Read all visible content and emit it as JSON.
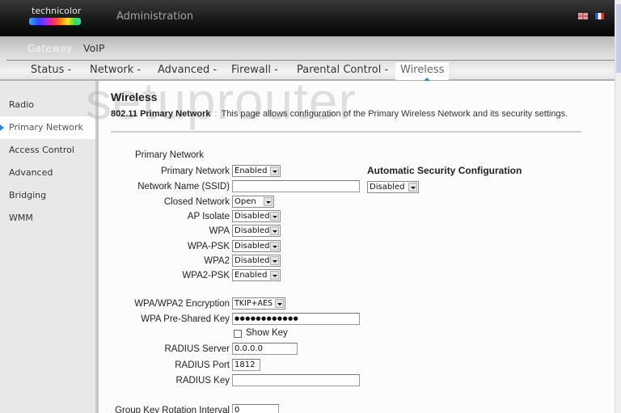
{
  "header": {
    "brand": "technicolor",
    "title": "Administration",
    "languages": [
      {
        "code": "en",
        "icon": "uk-flag-icon"
      },
      {
        "code": "fr",
        "icon": "france-flag-icon"
      }
    ]
  },
  "subnav": {
    "items": [
      {
        "label": "Gateway",
        "active": true
      },
      {
        "label": "VoIP",
        "active": false
      }
    ]
  },
  "mainnav": {
    "items": [
      {
        "label": "Status -"
      },
      {
        "label": "Network -"
      },
      {
        "label": "Advanced -"
      },
      {
        "label": "Firewall -"
      },
      {
        "label": "Parental Control -"
      },
      {
        "label": "Wireless",
        "active": true
      }
    ]
  },
  "sidebar": {
    "items": [
      {
        "label": "Radio"
      },
      {
        "label": "Primary Network",
        "active": true
      },
      {
        "label": "Access Control"
      },
      {
        "label": "Advanced"
      },
      {
        "label": "Bridging"
      },
      {
        "label": "WMM"
      }
    ]
  },
  "page": {
    "watermark": "setuprouter",
    "title": "Wireless",
    "desc_strong": "802.11 Primary Network",
    "desc_sep": ":",
    "desc_text": "This page allows configuration of the Primary Wireless Network and its security settings.",
    "section_label": "Primary Network"
  },
  "form": {
    "primary_network": {
      "label": "Primary Network",
      "value": "Enabled"
    },
    "ssid": {
      "label": "Network Name (SSID)",
      "value": ""
    },
    "closed_network": {
      "label": "Closed Network",
      "value": "Open"
    },
    "ap_isolate": {
      "label": "AP Isolate",
      "value": "Disabled"
    },
    "wpa": {
      "label": "WPA",
      "value": "Disabled"
    },
    "wpa_psk": {
      "label": "WPA-PSK",
      "value": "Disabled"
    },
    "wpa2": {
      "label": "WPA2",
      "value": "Disabled"
    },
    "wpa2_psk": {
      "label": "WPA2-PSK",
      "value": "Enabled"
    },
    "encryption": {
      "label": "WPA/WPA2 Encryption",
      "value": "TKIP+AES"
    },
    "psk": {
      "label": "WPA Pre-Shared Key",
      "value": "●●●●●●●●●●●●"
    },
    "show_key": {
      "label": "Show Key",
      "checked": false
    },
    "radius_server": {
      "label": "RADIUS Server",
      "value": "0.0.0.0"
    },
    "radius_port": {
      "label": "RADIUS Port",
      "value": "1812"
    },
    "radius_key": {
      "label": "RADIUS Key",
      "value": ""
    },
    "group_key_interval": {
      "label": "Group Key Rotation Interval",
      "value": "0"
    }
  },
  "auto_security": {
    "title": "Automatic Security Configuration",
    "value": "Disabled"
  }
}
